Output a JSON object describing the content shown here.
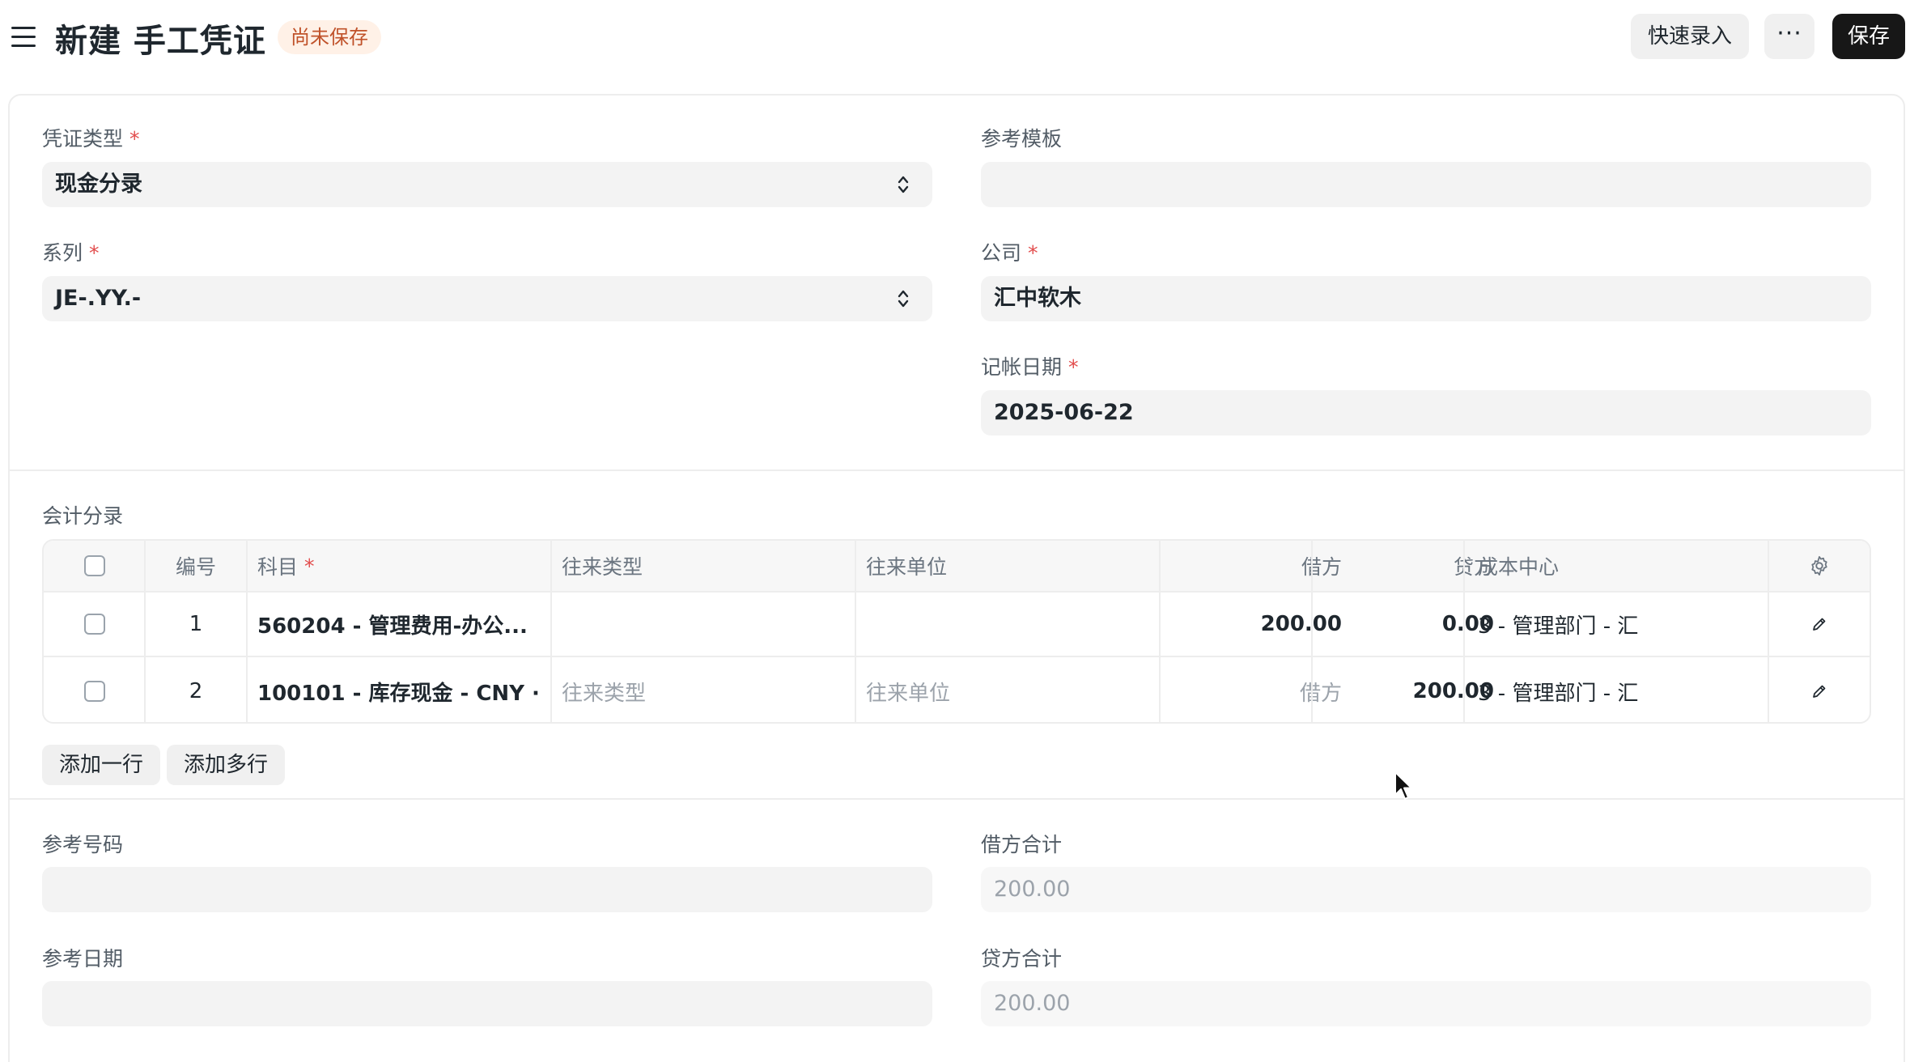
{
  "header": {
    "title": "新建 手工凭证",
    "status_badge": "尚未保存",
    "quick_entry_label": "快速录入",
    "more_label": "···",
    "save_label": "保存"
  },
  "form": {
    "voucher_type": {
      "label": "凭证类型",
      "value": "现金分录"
    },
    "reference_template": {
      "label": "参考模板",
      "value": ""
    },
    "series": {
      "label": "系列",
      "value": "JE-.YY.-"
    },
    "company": {
      "label": "公司",
      "value": "汇中软木"
    },
    "posting_date": {
      "label": "记帐日期",
      "value": "2025-06-22"
    },
    "required_mark": "*"
  },
  "accounts_table": {
    "title": "会计分录",
    "columns": {
      "no": "编号",
      "account": "科目",
      "party_type": "往来类型",
      "party": "往来单位",
      "debit": "借方",
      "credit": "贷方",
      "cost_center": "成本中心"
    },
    "rows": [
      {
        "no": "1",
        "account": "560204 - 管理费用-办公...",
        "party_type": "",
        "party": "",
        "debit": "200.00",
        "credit": "0.00",
        "cost_center": "3 - 管理部门 - 汇"
      },
      {
        "no": "2",
        "account": "100101 - 库存现金 - CNY ·",
        "party_type": "往来类型",
        "party": "往来单位",
        "debit": "借方",
        "credit": "200.00",
        "cost_center": "3 - 管理部门 - 汇"
      }
    ],
    "add_row_label": "添加一行",
    "add_multiple_label": "添加多行"
  },
  "bottom": {
    "reference_number": {
      "label": "参考号码",
      "value": ""
    },
    "reference_date": {
      "label": "参考日期",
      "value": ""
    },
    "total_debit": {
      "label": "借方合计",
      "value": "200.00"
    },
    "total_credit": {
      "label": "贷方合计",
      "value": "200.00"
    }
  },
  "icons": {
    "menu": "hamburger-icon",
    "select": "chevron-updown-icon",
    "settings": "gear-icon",
    "edit": "pencil-icon",
    "cursor": "mouse-cursor-icon"
  },
  "colors": {
    "primary_button": "#171717",
    "badge_bg": "#fff1e7",
    "badge_text": "#c0522a",
    "required": "#e24c4c",
    "field_bg": "#f3f3f3"
  }
}
